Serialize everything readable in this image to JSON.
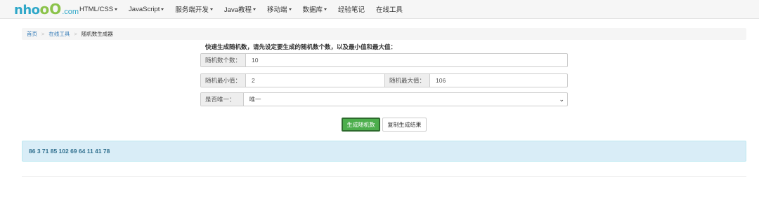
{
  "logo": {
    "part1": "nho",
    "part2": "oO",
    "part3": ".com"
  },
  "nav": [
    {
      "label": "HTML/CSS",
      "dropdown": true
    },
    {
      "label": "JavaScript",
      "dropdown": true
    },
    {
      "label": "服务端开发",
      "dropdown": true
    },
    {
      "label": "Java教程",
      "dropdown": true
    },
    {
      "label": "移动端",
      "dropdown": true
    },
    {
      "label": "数据库",
      "dropdown": true
    },
    {
      "label": "经验笔记",
      "dropdown": false
    },
    {
      "label": "在线工具",
      "dropdown": false
    }
  ],
  "breadcrumb": {
    "home": "首页",
    "tools": "在线工具",
    "current": "随机数生成器",
    "separator": ">"
  },
  "intro": "快速生成随机数，请先设定要生成的随机数个数，以及最小值和最大值：",
  "form": {
    "count_label": "随机数个数：",
    "count_value": "10",
    "min_label": "随机最小值：",
    "min_value": "2",
    "max_label": "随机最大值：",
    "max_value": "106",
    "unique_label": "是否唯一：",
    "unique_value": "唯一"
  },
  "buttons": {
    "generate": "生成随机数",
    "copy": "复制生成结果"
  },
  "result": "86 3 71 85 102 69 64 11 41 78",
  "colors": {
    "logo_blue": "#2ea7c8",
    "logo_green": "#8bc34a",
    "generate_button": "#4cae4c",
    "result_bg": "#d9edf7",
    "result_text": "#31708f",
    "link": "#337ab7"
  }
}
